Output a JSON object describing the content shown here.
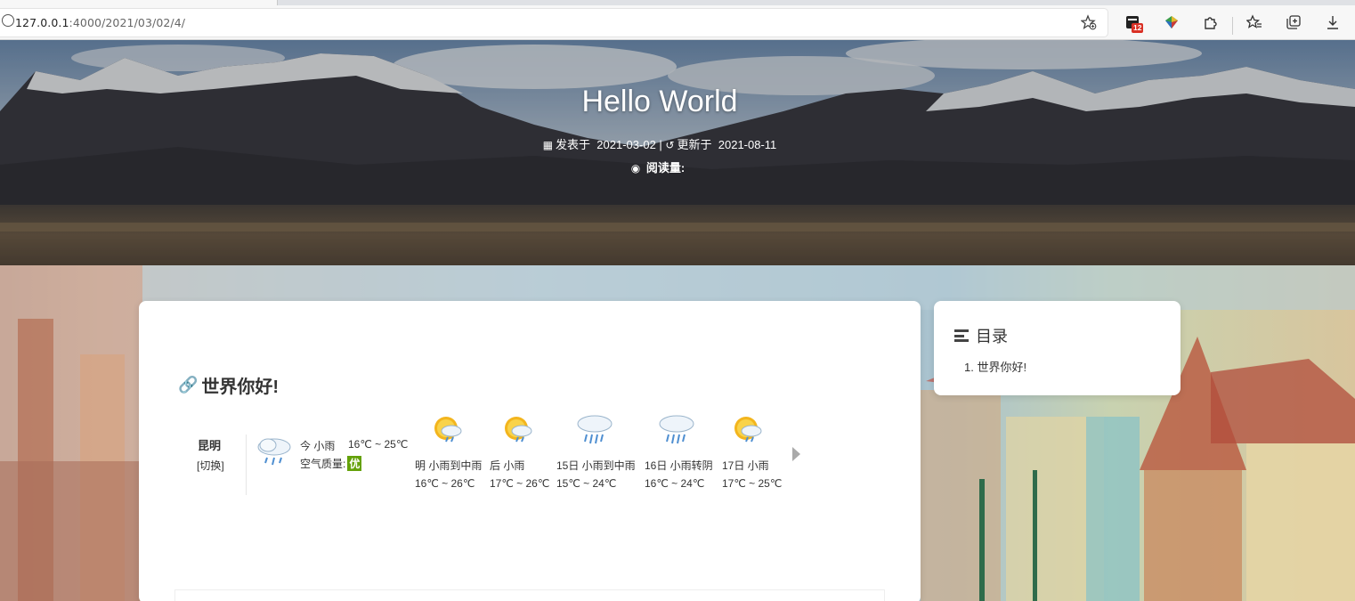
{
  "browser": {
    "url_host": "127.0.0.1",
    "url_path": ":4000/2021/03/02/4/",
    "extension_badge": "12"
  },
  "post": {
    "title": "Hello World",
    "published_label": "发表于",
    "published_date": "2021-03-02",
    "separator": "|",
    "updated_label": "更新于",
    "updated_date": "2021-08-11",
    "views_label": "阅读量:"
  },
  "content": {
    "heading": "世界你好!"
  },
  "weather": {
    "city": "昆明",
    "switch_label": "[切换]",
    "today": {
      "desc": "今 小雨",
      "temp": "16℃ ~ 25℃",
      "icon": "rain-cloud-icon"
    },
    "air_quality_label": "空气质量:",
    "air_quality_value": "优",
    "forecast": [
      {
        "label": "明 小雨到中雨",
        "temp": "16℃ ~ 26℃",
        "icon": "sun-rain-icon"
      },
      {
        "label": "后 小雨",
        "temp": "17℃ ~ 26℃",
        "icon": "sun-rain-icon"
      },
      {
        "label": "15日 小雨到中雨",
        "temp": "15℃ ~ 24℃",
        "icon": "rain-cloud-icon"
      },
      {
        "label": "16日 小雨转阴",
        "temp": "16℃ ~ 24℃",
        "icon": "rain-cloud-icon"
      },
      {
        "label": "17日 小雨",
        "temp": "17℃ ~ 25℃",
        "icon": "sun-rain-icon"
      }
    ]
  },
  "toc": {
    "title": "目录",
    "items": [
      "1. 世界你好!"
    ]
  }
}
